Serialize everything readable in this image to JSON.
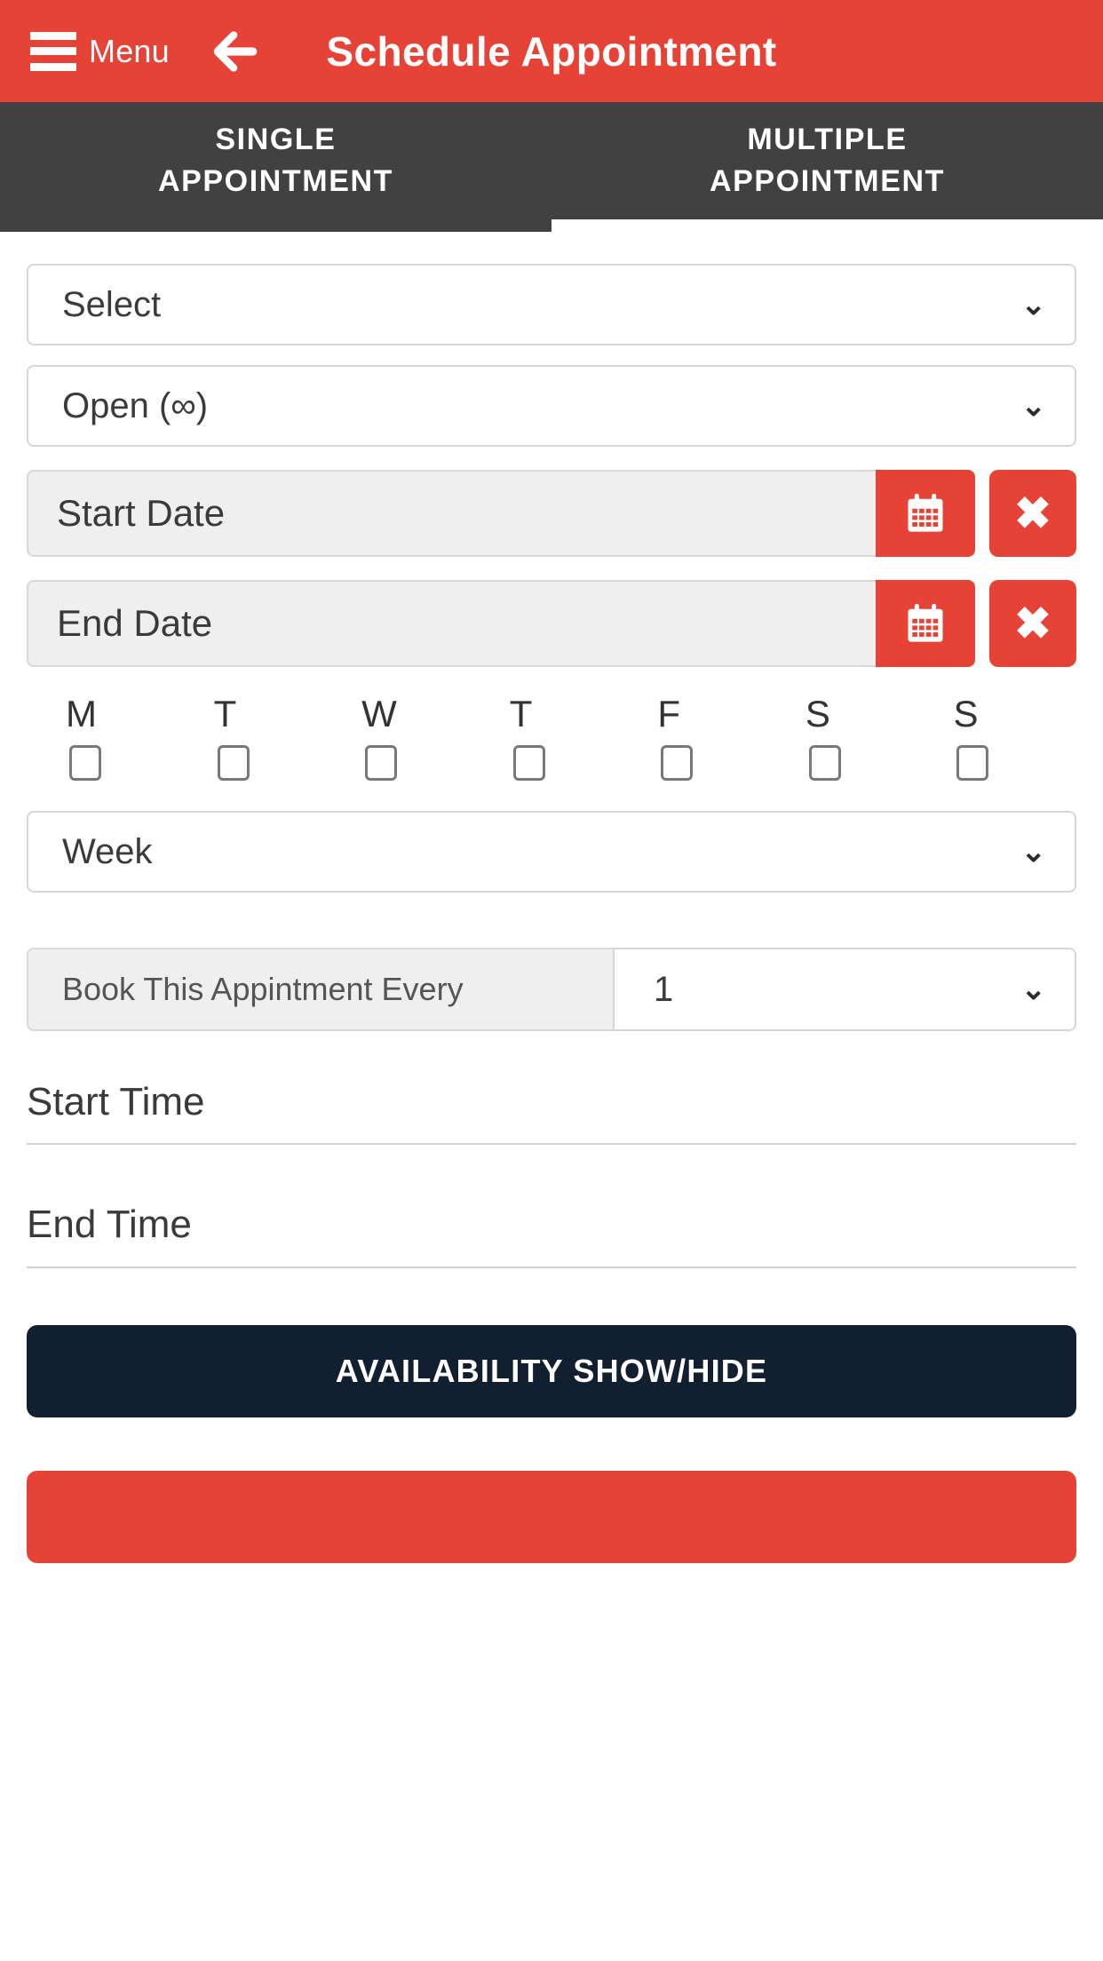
{
  "colors": {
    "brand_red": "#e74236",
    "tab_bar": "#414141",
    "dark_navy": "#121f2e",
    "field_gray": "#efefef"
  },
  "header": {
    "menu_label": "Menu",
    "title": "Schedule Appointment",
    "menu_icon": "hamburger-icon",
    "back_icon": "arrow-left-icon"
  },
  "tabs": [
    {
      "label": "SINGLE\nAPPOINTMENT",
      "line1": "SINGLE",
      "line2": "APPOINTMENT",
      "active": false
    },
    {
      "label": "MULTIPLE\nAPPOINTMENT",
      "line1": "MULTIPLE",
      "line2": "APPOINTMENT",
      "active": true
    }
  ],
  "form": {
    "service_select": {
      "value": "Select",
      "chevron": "⌄"
    },
    "duration_select": {
      "value": "Open (∞)",
      "chevron": "⌄"
    },
    "start_date": {
      "placeholder": "Start Date",
      "calendar_icon": "calendar-icon",
      "clear_icon": "close-icon",
      "clear_glyph": "✖"
    },
    "end_date": {
      "placeholder": "End Date",
      "calendar_icon": "calendar-icon",
      "clear_icon": "close-icon",
      "clear_glyph": "✖"
    },
    "weekdays": [
      {
        "letter": "M",
        "name": "monday",
        "checked": false
      },
      {
        "letter": "T",
        "name": "tuesday",
        "checked": false
      },
      {
        "letter": "W",
        "name": "wednesday",
        "checked": false
      },
      {
        "letter": "T",
        "name": "thursday",
        "checked": false
      },
      {
        "letter": "F",
        "name": "friday",
        "checked": false
      },
      {
        "letter": "S",
        "name": "saturday",
        "checked": false
      },
      {
        "letter": "S",
        "name": "sunday",
        "checked": false
      }
    ],
    "frequency_select": {
      "value": "Week",
      "chevron": "⌄"
    },
    "repeat": {
      "label": "Book This Appintment Every",
      "value": "1",
      "chevron": "⌄"
    },
    "start_time": {
      "placeholder": "Start Time"
    },
    "end_time": {
      "placeholder": "End Time"
    }
  },
  "actions": {
    "availability_button": "AVAILABILITY SHOW/HIDE",
    "submit_button": ""
  }
}
